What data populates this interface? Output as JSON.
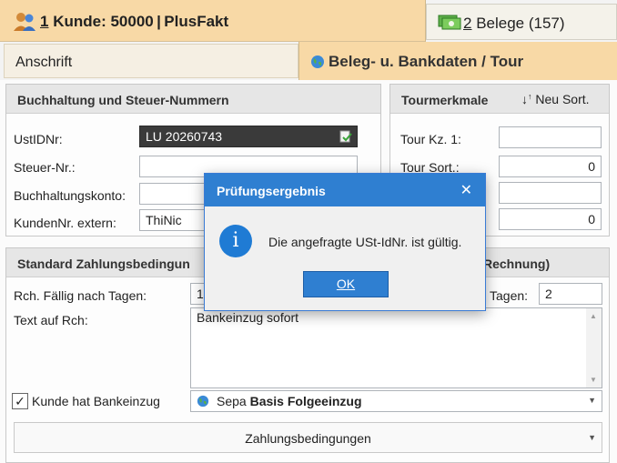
{
  "tabs": {
    "customer": {
      "number": "1",
      "label": " Kunde: 50000 | PlusFakt"
    },
    "documents": {
      "number": "2",
      "label": " Belege (157)"
    }
  },
  "subtabs": {
    "address": "Anschrift",
    "bankdata": "Beleg- u. Bankdaten / Tour"
  },
  "accounting": {
    "title": "Buchhaltung und Steuer-Nummern",
    "vat_label": "UstIDNr:",
    "vat_value": "LU 20260743",
    "tax_label": "Steuer-Nr.:",
    "tax_value": "",
    "account_label": "Buchhaltungskonto:",
    "account_value": "",
    "extnum_label": "KundenNr. extern:",
    "extnum_value": "ThiNic"
  },
  "tour": {
    "title": "Tourmerkmale",
    "sort_label": "Neu Sort.",
    "kz1_label": "Tour Kz. 1:",
    "kz1_value": "",
    "sort_field_label": "Tour Sort.:",
    "sort_value": "0",
    "field3_value": "",
    "field4_value": "0"
  },
  "payment": {
    "title_left": "Standard Zahlungsbedingun",
    "title_right": "Rechnung)",
    "due_label": "Rch. Fällig nach Tagen:",
    "due_value": "1",
    "days_label": "Tagen:",
    "days_value": "2",
    "text_label": "Text auf Rch:",
    "text_value": "Bankeinzug sofort",
    "bank_checkbox_label": "Kunde hat Bankeinzug",
    "bank_checked": "✓",
    "sepa_prefix": "Sepa ",
    "sepa_bold": "Basis Folgeeinzug",
    "conditions_button": "Zahlungsbedingungen"
  },
  "dialog": {
    "title": "Prüfungsergebnis",
    "close": "✕",
    "icon": "i",
    "message": "Die angefragte USt-IdNr. ist gültig.",
    "ok": "OK"
  },
  "colors": {
    "active_tab": "#f8d9a6",
    "dialog_accent": "#2f7fd1"
  }
}
